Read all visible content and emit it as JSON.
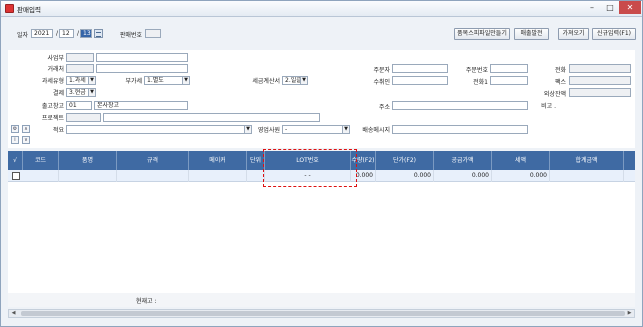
{
  "window": {
    "title": "판매입력",
    "min": "–",
    "max": "□",
    "close": "✕"
  },
  "top": {
    "date_label": "일자",
    "year": "2021",
    "month": "12",
    "day": "13",
    "slash": "/",
    "sale_no_label": "판매번호",
    "buttons": [
      "품목스피파일만들기",
      "매출발전",
      "가져오기",
      "신규입력(F1)"
    ]
  },
  "form": {
    "site_label": "사업부",
    "client_label": "거래처",
    "tax_type_label": "과세유형",
    "tax_type_value": "1.과세",
    "vat_label": "부가세",
    "vat_value": "1.별도",
    "invoice_label": "세금계산서",
    "invoice_value": "2.일괄",
    "settle_label": "결제",
    "settle_value": "3.현금",
    "warehouse_label": "출고창고",
    "warehouse_code": "01",
    "warehouse_name": "본사창고",
    "project_label": "프로젝트",
    "summary_label": "적요",
    "sales_rep_label": "영업사원",
    "sales_rep_value": "-",
    "delivery_msg_label": "배송메시지",
    "orderer_label": "주문자",
    "order_no_label": "주문번호",
    "receiver_label": "수취인",
    "phone1_label": "전화1",
    "address_label": "주소",
    "phone_label": "전화",
    "fax_label": "팩스",
    "receivable_label": "외상잔액",
    "note_label": "비고 ."
  },
  "grid": {
    "headers": [
      "√",
      "코드",
      "품명",
      "규격",
      "메이커",
      "단위",
      "LOT번호",
      "수량(F2)",
      "단가(F2)",
      "공급가액",
      "세액",
      "합계금액"
    ],
    "row": {
      "lot": "-  -",
      "qty": "0.000",
      "price": "0.000",
      "supply": "0.000",
      "tax": "0.000"
    }
  },
  "footer": {
    "stock_label": "현재고 :"
  }
}
